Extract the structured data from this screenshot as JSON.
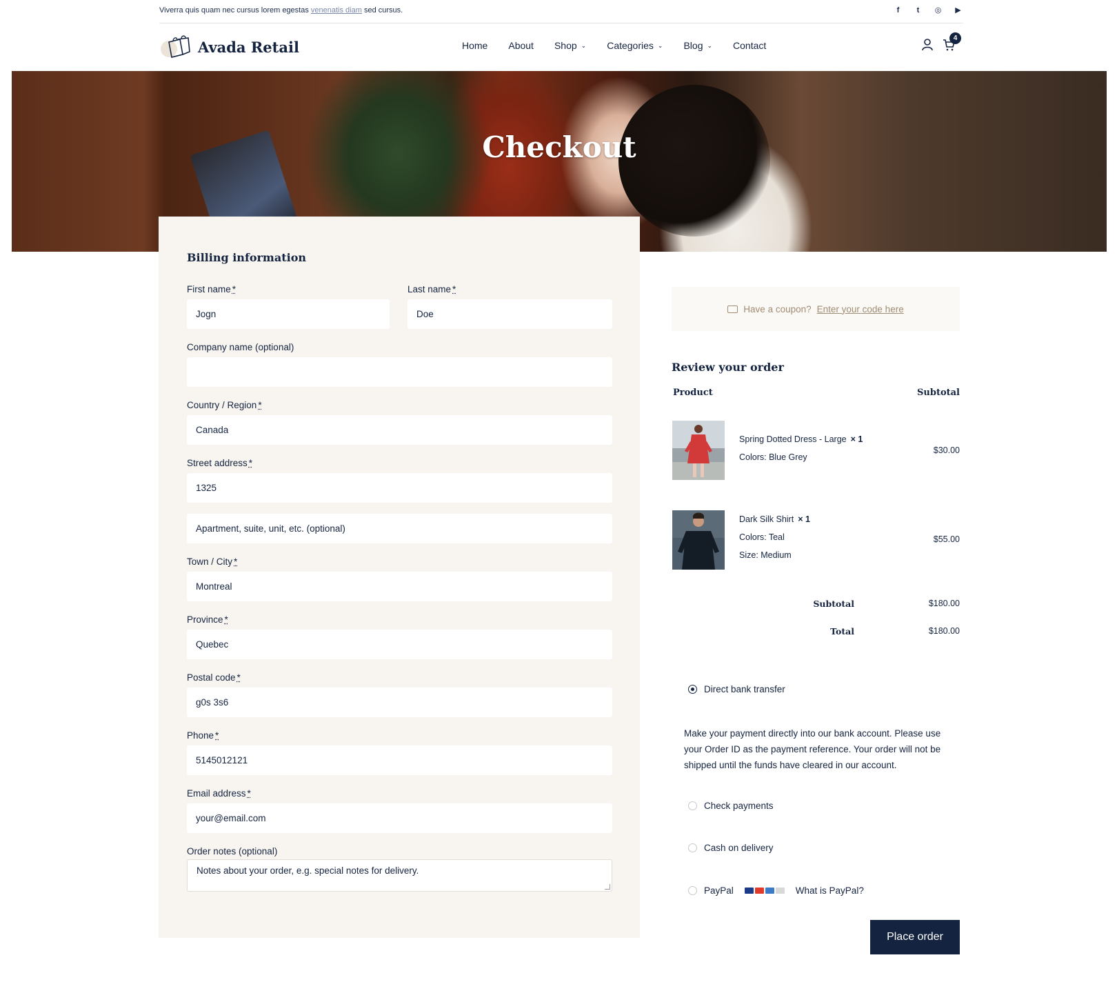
{
  "topbar": {
    "promo_before": "Viverra quis quam nec cursus lorem egestas",
    "promo_link": "venenatis diam",
    "promo_after": "sed cursus.",
    "social": [
      {
        "icon": "facebook-icon",
        "glyph": "f"
      },
      {
        "icon": "twitter-icon",
        "glyph": "t"
      },
      {
        "icon": "instagram-icon",
        "glyph": "◎"
      },
      {
        "icon": "youtube-icon",
        "glyph": "▶"
      }
    ]
  },
  "header": {
    "brand": "Avada Retail",
    "nav": [
      "Home",
      "About",
      "Shop",
      "Categories",
      "Blog",
      "Contact"
    ],
    "cart_count": "4"
  },
  "hero": {
    "title": "Checkout"
  },
  "billing": {
    "title": "Billing information",
    "first_name_label": "First name",
    "first_name_value": "Jogn",
    "last_name_label": "Last name",
    "last_name_value": "Doe",
    "company_label": "Company name (optional)",
    "company_value": "",
    "country_label": "Country / Region",
    "country_value": "Canada",
    "street_label": "Street address",
    "street_value": "1325",
    "apartment_placeholder": "Apartment, suite, unit, etc. (optional)",
    "city_label": "Town / City",
    "city_value": "Montreal",
    "province_label": "Province",
    "province_value": "Quebec",
    "postal_label": "Postal code",
    "postal_value": "g0s 3s6",
    "phone_label": "Phone",
    "phone_value": "5145012121",
    "email_label": "Email address",
    "email_value": "your@email.com",
    "notes_label": "Order notes (optional)",
    "notes_placeholder": "Notes about your order, e.g. special notes for delivery.",
    "required_mark": "*"
  },
  "coupon": {
    "prompt": "Have a coupon?",
    "link": "Enter your code here"
  },
  "review": {
    "title": "Review your order",
    "col_product": "Product",
    "col_subtotal": "Subtotal",
    "items": [
      {
        "name": "Spring Dotted Dress - Large",
        "qty": "× 1",
        "meta": [
          "Colors: Blue Grey"
        ],
        "price": "$30.00"
      },
      {
        "name": "Dark Silk Shirt",
        "qty": "× 1",
        "meta": [
          "Colors: Teal",
          "Size: Medium"
        ],
        "price": "$55.00"
      }
    ],
    "subtotal_label": "Subtotal",
    "subtotal_value": "$180.00",
    "total_label": "Total",
    "total_value": "$180.00"
  },
  "payment": {
    "options": [
      "Direct bank transfer",
      "Check payments",
      "Cash on delivery",
      "PayPal"
    ],
    "selected": "Direct bank transfer",
    "bank_description": "Make your payment directly into our bank account. Please use your Order ID as the payment reference. Your order will not be shipped until the funds have cleared in our account.",
    "paypal_link": "What is PayPal?",
    "place_order": "Place order"
  },
  "colors": {
    "navy": "#14233f",
    "panel_bg": "#f8f5f1",
    "coupon_text": "#a08c72"
  }
}
